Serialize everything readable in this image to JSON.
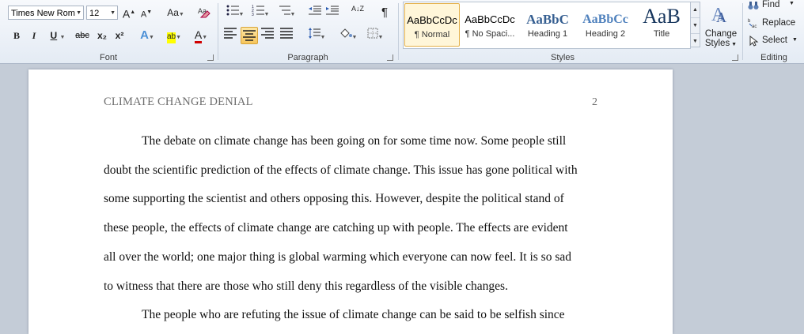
{
  "font": {
    "font_name": "Times New Rom",
    "font_size": "12",
    "grow": "A",
    "shrink": "A",
    "change_case": "Aa",
    "bold": "B",
    "italic": "I",
    "underline": "U",
    "strikethrough": "abc",
    "subscript": "x₂",
    "superscript": "x²",
    "text_effects": "A",
    "highlight": "ab",
    "font_color": "A",
    "group_label": "Font"
  },
  "paragraph": {
    "sort": "A↓Z",
    "show_marks": "¶",
    "group_label": "Paragraph"
  },
  "styles": {
    "items": [
      {
        "preview": "AaBbCcDc",
        "name": "¶ Normal"
      },
      {
        "preview": "AaBbCcDc",
        "name": "¶ No Spaci..."
      },
      {
        "preview": "AaBbC",
        "name": "Heading 1"
      },
      {
        "preview": "AaBbCc",
        "name": "Heading 2"
      },
      {
        "preview": "AaB",
        "name": "Title"
      }
    ],
    "change_styles_line1": "Change",
    "change_styles_line2": "Styles",
    "group_label": "Styles"
  },
  "editing": {
    "find": "Find",
    "replace": "Replace",
    "select": "Select",
    "group_label": "Editing"
  },
  "document": {
    "header_title": "CLIMATE CHANGE DENIAL",
    "page_number": "2",
    "lines": [
      "The debate on climate change has been going on for some time now. Some people still",
      "doubt the scientific prediction of the effects of climate  change. This issue has gone political with",
      "some supporting the scientist and others opposing this. However, despite the political stand of",
      "these people, the effects of climate change are catching up with people. The effects are evident",
      "all over the world; one major thing is global warming which everyone can now feel. It is so sad",
      "to witness that there are those who still deny this regardless of the visible  changes.",
      "The people who are refuting the issue of climate change can be said to be selfish since"
    ]
  },
  "colors": {
    "accent_selected": "#f6c55b",
    "heading_blue": "#365f91",
    "highlight_yellow": "#ffff00",
    "font_color_red": "#d00000"
  }
}
